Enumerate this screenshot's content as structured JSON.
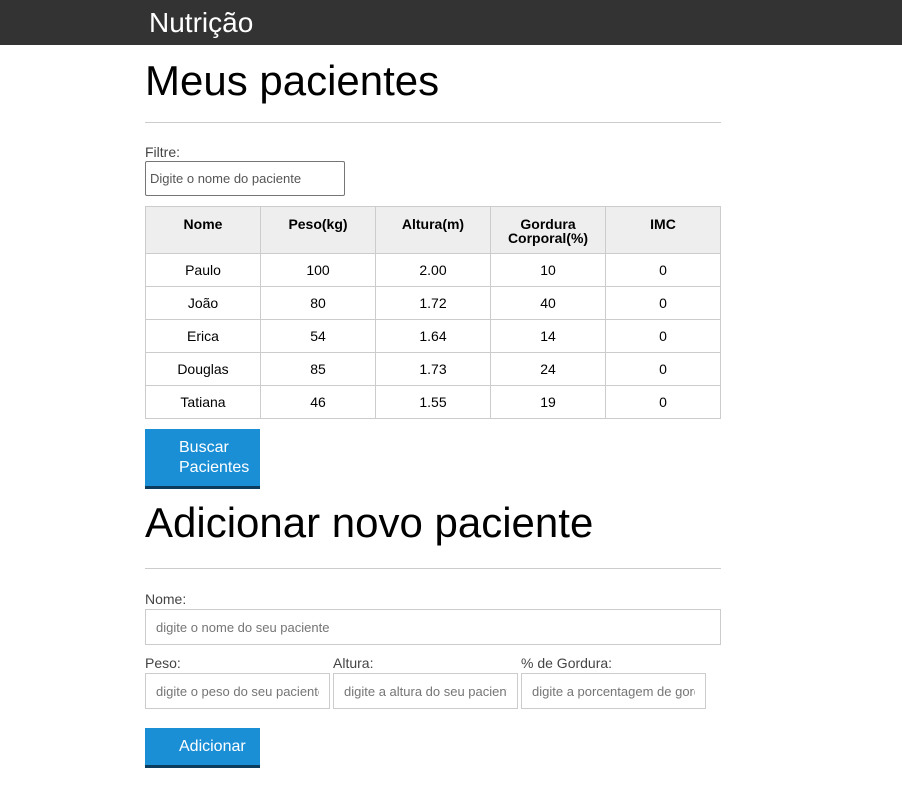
{
  "navbar": {
    "brand": "Nutrição"
  },
  "patients_section": {
    "title": "Meus pacientes",
    "filter": {
      "label": "Filtre:",
      "placeholder": "Digite o nome do paciente",
      "value": ""
    },
    "table": {
      "headers": [
        "Nome",
        "Peso(kg)",
        "Altura(m)",
        "Gordura Corporal(%)",
        "IMC"
      ],
      "rows": [
        [
          "Paulo",
          "100",
          "2.00",
          "10",
          "0"
        ],
        [
          "João",
          "80",
          "1.72",
          "40",
          "0"
        ],
        [
          "Erica",
          "54",
          "1.64",
          "14",
          "0"
        ],
        [
          "Douglas",
          "85",
          "1.73",
          "24",
          "0"
        ],
        [
          "Tatiana",
          "46",
          "1.55",
          "19",
          "0"
        ]
      ]
    },
    "search_button": {
      "line1": "Buscar",
      "line2": "Pacientes"
    }
  },
  "add_section": {
    "title": "Adicionar novo paciente",
    "name": {
      "label": "Nome:",
      "placeholder": "digite o nome do seu paciente"
    },
    "weight": {
      "label": "Peso:",
      "placeholder": "digite o peso do seu paciente"
    },
    "height": {
      "label": "Altura:",
      "placeholder": "digite a altura do seu paciente"
    },
    "fat": {
      "label": "% de Gordura:",
      "placeholder": "digite a porcentagem de gordura"
    },
    "add_button": "Adicionar"
  },
  "colors": {
    "navbar_bg": "#333333",
    "button_bg": "#1a8fd6",
    "button_border": "#0b3c5d",
    "table_header_bg": "#eeeeee"
  }
}
